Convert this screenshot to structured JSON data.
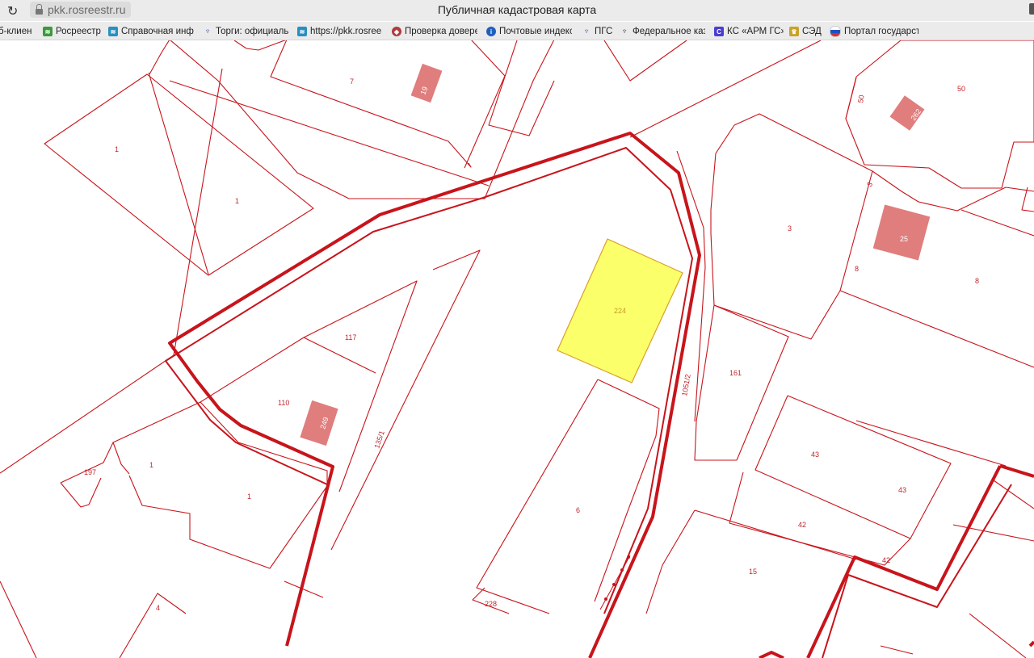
{
  "browser": {
    "address": "pkk.rosreestr.ru",
    "title": "Публичная кадастровая карта",
    "reload_icon": "reload-icon",
    "bookmarks": [
      {
        "label": "б-клиен",
        "icon": "none"
      },
      {
        "label": "Росреестр",
        "icon": "rosreestr-icon",
        "color": "#3a9a3a"
      },
      {
        "label": "Справочная инфо",
        "icon": "rosreestr-icon",
        "color": "#2a8fbf"
      },
      {
        "label": "Торги: официальн",
        "icon": "eagle-icon",
        "color": "#5a6fb0"
      },
      {
        "label": "https://pkk.rosree",
        "icon": "rosreestr-icon",
        "color": "#2a8fbf"
      },
      {
        "label": "Проверка довере",
        "icon": "shield-icon",
        "color": "#b03a3a"
      },
      {
        "label": "Почтовые индекс",
        "icon": "info-icon",
        "color": "#1f5fbf"
      },
      {
        "label": "ПГС",
        "icon": "eagle-icon",
        "color": "#5a6fb0"
      },
      {
        "label": "Федеральное каз",
        "icon": "eagle-icon",
        "color": "#555555"
      },
      {
        "label": "КС «АРМ ГС»",
        "icon": "c-icon",
        "color": "#4a3fcf"
      },
      {
        "label": "СЭД",
        "icon": "crest-icon",
        "color": "#c9a227"
      },
      {
        "label": "Портал государст",
        "icon": "flag-icon",
        "color": "#d32f2f"
      }
    ]
  },
  "map": {
    "colors": {
      "line": "#c8141b",
      "building_fill": "#e07d7d",
      "selected_fill": "#fbff6a",
      "selected_border": "#d8a12a"
    },
    "labels": {
      "l7": "7",
      "l19": "19",
      "l50a": "50",
      "l50b": "50",
      "l262": "262",
      "l1a": "1",
      "l1b": "1",
      "l3a": "3",
      "l3b": "3",
      "l25": "25",
      "l8a": "8",
      "l8b": "8",
      "l224": "224",
      "l117": "117",
      "l110": "110",
      "l249": "249",
      "l1351": "135/1",
      "l10512": "1051/2",
      "l161": "161",
      "l197": "197",
      "l1c": "1",
      "l1d": "1",
      "l6": "6",
      "l43a": "43",
      "l43b": "43",
      "l42a": "42",
      "l42b": "42",
      "l15": "15",
      "l228": "228",
      "l4": "4"
    }
  }
}
